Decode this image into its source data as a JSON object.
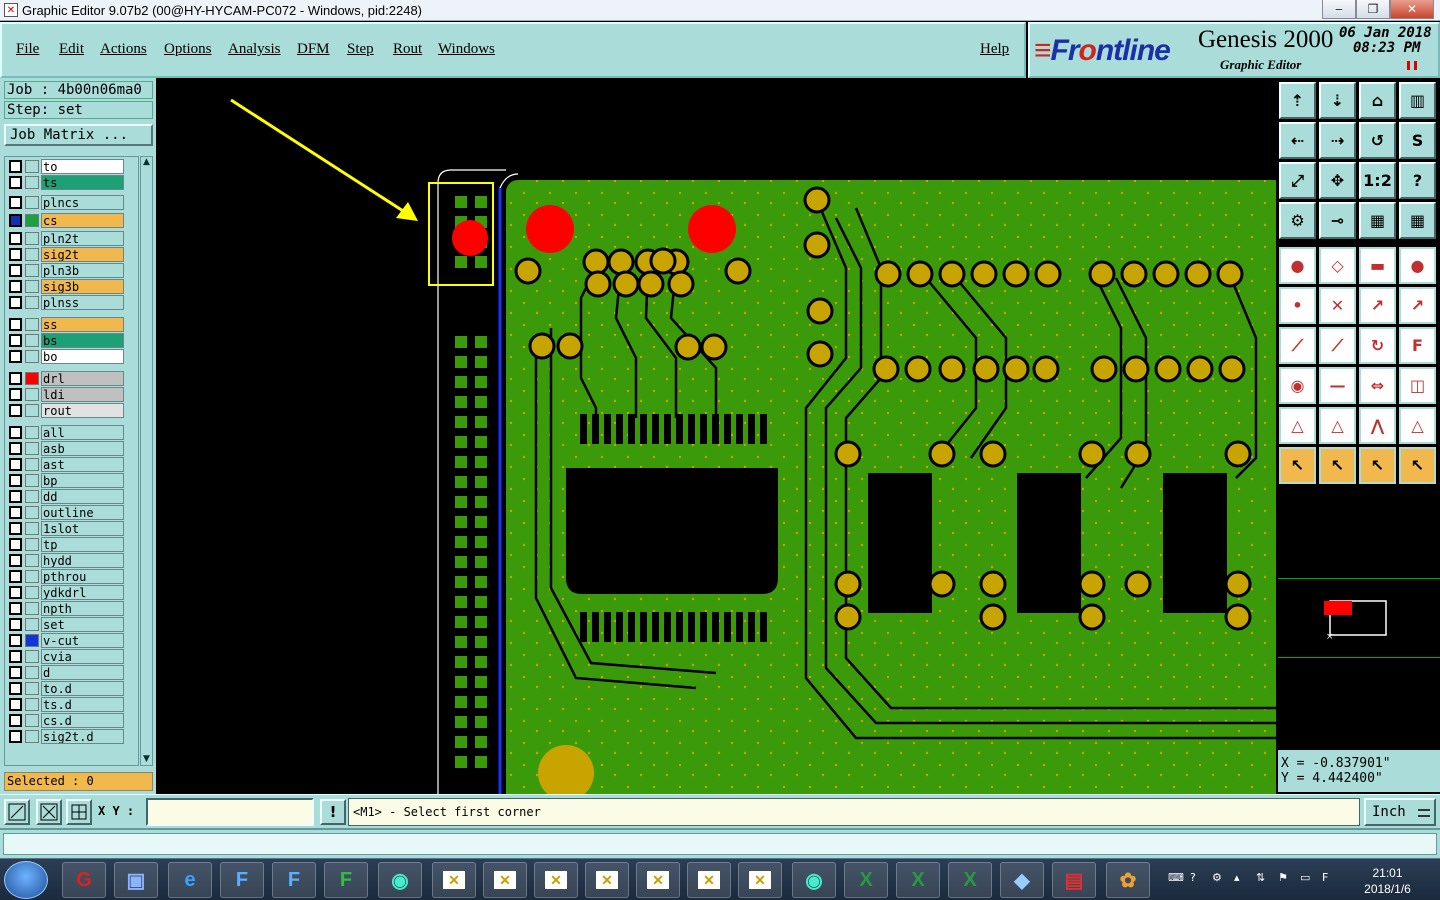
{
  "window": {
    "title": "Graphic Editor 9.07b2 (00@HY-HYCAM-PC072 - Windows, pid:2248)"
  },
  "menu": [
    {
      "label": "File"
    },
    {
      "label": "Edit"
    },
    {
      "label": "Actions"
    },
    {
      "label": "Options"
    },
    {
      "label": "Analysis"
    },
    {
      "label": "DFM"
    },
    {
      "label": "Step"
    },
    {
      "label": "Rout"
    },
    {
      "label": "Windows"
    },
    {
      "label": "Help"
    }
  ],
  "brand": {
    "logo_prefix": "Fr",
    "logo_dot": "o",
    "logo_suffix": "ntline",
    "product": "Genesis 2000",
    "subtitle": "Graphic Editor",
    "date": "06 Jan 2018",
    "time": "08:23 PM"
  },
  "job": {
    "job_line": "Job : 4b00n06ma0",
    "step_line": "Step: set",
    "matrix_button": "Job Matrix ..."
  },
  "layers": [
    {
      "name": "to",
      "bg": "#ffffff",
      "swatch": "",
      "checked": false
    },
    {
      "name": "ts",
      "bg": "#1ea077",
      "swatch": "",
      "checked": false
    },
    {
      "name": "plncs",
      "bg": "#aadcd9",
      "swatch": "",
      "checked": false
    },
    {
      "name": "cs",
      "bg": "#f0b84d",
      "swatch": "#1ea040",
      "checked": true
    },
    {
      "name": "pln2t",
      "bg": "#aadcd9",
      "swatch": "",
      "checked": false
    },
    {
      "name": "sig2t",
      "bg": "#f0b84d",
      "swatch": "",
      "checked": false
    },
    {
      "name": "pln3b",
      "bg": "#aadcd9",
      "swatch": "",
      "checked": false
    },
    {
      "name": "sig3b",
      "bg": "#f0b84d",
      "swatch": "",
      "checked": false
    },
    {
      "name": "plnss",
      "bg": "#aadcd9",
      "swatch": "",
      "checked": false
    },
    {
      "name": "ss",
      "bg": "#f0b84d",
      "swatch": "",
      "checked": false
    },
    {
      "name": "bs",
      "bg": "#1ea077",
      "swatch": "",
      "checked": false
    },
    {
      "name": "bo",
      "bg": "#ffffff",
      "swatch": "",
      "checked": false
    },
    {
      "name": "drl",
      "bg": "#c0c0c0",
      "swatch": "#ff0000",
      "checked": false
    },
    {
      "name": "ldi",
      "bg": "#c0c0c0",
      "swatch": "",
      "checked": false
    },
    {
      "name": "rout",
      "bg": "#e2e2e2",
      "swatch": "",
      "checked": false
    },
    {
      "name": "all",
      "bg": "#aadcd9",
      "swatch": "",
      "checked": false
    },
    {
      "name": "asb",
      "bg": "#aadcd9",
      "swatch": "",
      "checked": false
    },
    {
      "name": "ast",
      "bg": "#aadcd9",
      "swatch": "",
      "checked": false
    },
    {
      "name": "bp",
      "bg": "#aadcd9",
      "swatch": "",
      "checked": false
    },
    {
      "name": "dd",
      "bg": "#aadcd9",
      "swatch": "",
      "checked": false
    },
    {
      "name": "outline",
      "bg": "#aadcd9",
      "swatch": "",
      "checked": false
    },
    {
      "name": "1slot",
      "bg": "#aadcd9",
      "swatch": "",
      "checked": false
    },
    {
      "name": "tp",
      "bg": "#aadcd9",
      "swatch": "",
      "checked": false
    },
    {
      "name": "hydd",
      "bg": "#aadcd9",
      "swatch": "",
      "checked": false
    },
    {
      "name": "pthrou",
      "bg": "#aadcd9",
      "swatch": "",
      "checked": false
    },
    {
      "name": "ydkdrl",
      "bg": "#aadcd9",
      "swatch": "",
      "checked": false
    },
    {
      "name": "npth",
      "bg": "#aadcd9",
      "swatch": "",
      "checked": false
    },
    {
      "name": "set",
      "bg": "#aadcd9",
      "swatch": "",
      "checked": false
    },
    {
      "name": "v-cut",
      "bg": "#aadcd9",
      "swatch": "#1434d8",
      "checked": false
    },
    {
      "name": "cvia",
      "bg": "#aadcd9",
      "swatch": "",
      "checked": false
    },
    {
      "name": "d",
      "bg": "#aadcd9",
      "swatch": "",
      "checked": false
    },
    {
      "name": "to.d",
      "bg": "#aadcd9",
      "swatch": "",
      "checked": false
    },
    {
      "name": "ts.d",
      "bg": "#aadcd9",
      "swatch": "",
      "checked": false
    },
    {
      "name": "cs.d",
      "bg": "#aadcd9",
      "swatch": "",
      "checked": false
    },
    {
      "name": "sig2t.d",
      "bg": "#aadcd9",
      "swatch": "",
      "checked": false
    }
  ],
  "selected": "Selected : 0",
  "coords": {
    "x": "X = -0.837901\"",
    "y": "Y = 4.442400\""
  },
  "bottom": {
    "xy_label": "X Y :",
    "xy_value": "",
    "prompt": "<M1> - Select first corner",
    "units": "Inch"
  },
  "taskbar": {
    "time": "21:01",
    "date": "2018/1/6"
  },
  "colors": {
    "panel": "#aadcd9",
    "board": "#3a9a0a",
    "copper": "#c8a400",
    "highlight": "#ffff00",
    "pad_red": "#ff0000"
  },
  "toolbar_icons": [
    "zoom-home-icon",
    "zoom-page-icon",
    "zoom-window-icon",
    "zoom-area-icon",
    "pan-left-icon",
    "pan-right-icon",
    "zoom-back-icon",
    "redraw-icon",
    "fit-icon",
    "center-icon",
    "ratio-icon",
    "help-icon",
    "snap-icon",
    "measure-icon",
    "feature-info-icon",
    "layer-info-icon",
    "add-pad-icon",
    "add-surface-icon",
    "ruler-icon",
    "add-circle-icon",
    "connect-icon",
    "cross-icon",
    "move-icon",
    "copy-icon",
    "line-icon",
    "edit-line-icon",
    "rotate-icon",
    "mirror-icon",
    "select-icon",
    "trace-icon",
    "measure-dist-icon",
    "group-icon",
    "triangle-icon",
    "arrow-up-icon",
    "arc-icon",
    "triangle-down-icon",
    "pointer-icon",
    "select-box-icon",
    "select-cursor-icon",
    "cursor-options-icon"
  ]
}
